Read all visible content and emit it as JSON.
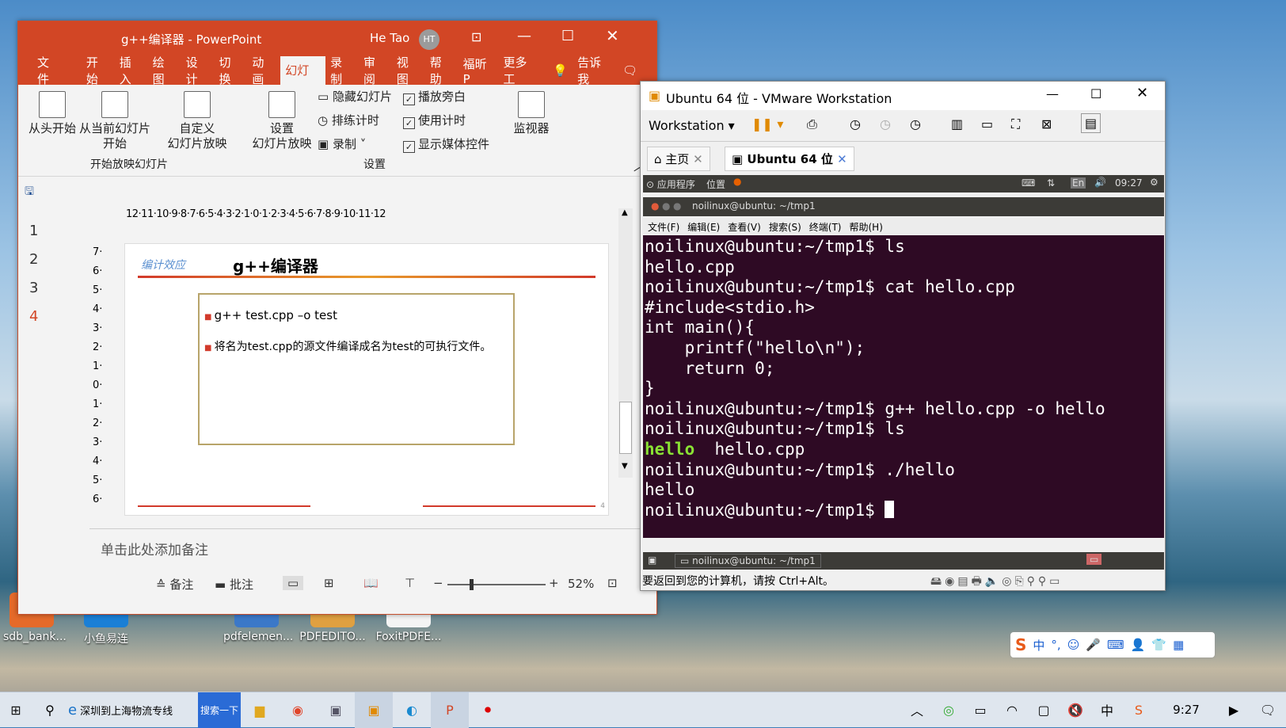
{
  "desktop": {
    "icons": [
      {
        "label": "sdb_bank..."
      },
      {
        "label": "小鱼易连"
      },
      {
        "label": "pdfelemen..."
      },
      {
        "label": "PDFEDITO..."
      },
      {
        "label": "FoxitPDFE..."
      }
    ]
  },
  "ppt": {
    "title": "g++编译器  -  PowerPoint",
    "user": "He Tao",
    "user_initials": "HT",
    "tabs": [
      "文件",
      "开始",
      "插入",
      "绘图",
      "设计",
      "切换",
      "动画",
      "幻灯片",
      "录制",
      "审阅",
      "视图",
      "帮助",
      "福昕P",
      "更多工",
      "告诉我"
    ],
    "ribbon": {
      "from_start": "从头开始",
      "from_current": "从当前幻灯片\n开始",
      "custom": "自定义\n幻灯片放映",
      "group1": "开始放映幻灯片",
      "setup": "设置\n幻灯片放映",
      "hide": "隐藏幻灯片",
      "rehearse": "排练计时",
      "record": "录制",
      "narration": "播放旁白",
      "timing": "使用计时",
      "media": "显示媒体控件",
      "group2": "设置",
      "monitor": "监视器"
    },
    "slides": [
      "1",
      "2",
      "3",
      "4"
    ],
    "ruler": "12·11·10·9·8·7·6·5·4·3·2·1·0·1·2·3·4·5·6·7·8·9·10·11·12",
    "vruler": "7·6·5·4·3·2·1·0·1·2·3·4·5·6·7",
    "slide": {
      "logo": "编计效应",
      "title": "g++编译器",
      "bullet1": "g++ test.cpp  –o test",
      "bullet2": "将名为test.cpp的源文件编译成名为test的可执行文件。",
      "page": "4"
    },
    "notes": "单击此处添加备注",
    "status": {
      "notes_btn": "备注",
      "comments_btn": "批注",
      "zoom": "52%"
    }
  },
  "vm": {
    "title": "Ubuntu 64 位 - VMware Workstation",
    "menu": "Workstation",
    "tabs": [
      "主页",
      "Ubuntu 64 位"
    ],
    "topbar": {
      "apps": "应用程序",
      "places": "位置",
      "time": "09:27",
      "lang": "En"
    },
    "term_title": "noilinux@ubuntu: ~/tmp1",
    "term_menu": [
      "文件(F)",
      "编辑(E)",
      "查看(V)",
      "搜索(S)",
      "终端(T)",
      "帮助(H)"
    ],
    "lines": [
      "noilinux@ubuntu:~/tmp1$ ls",
      "hello.cpp",
      "noilinux@ubuntu:~/tmp1$ cat hello.cpp",
      "#include<stdio.h>",
      "int main(){",
      "    printf(\"hello\\n\");",
      "    return 0;",
      "}",
      "noilinux@ubuntu:~/tmp1$ g++ hello.cpp -o hello",
      "noilinux@ubuntu:~/tmp1$ ls"
    ],
    "ls_hello": "hello",
    "ls_cpp": "  hello.cpp",
    "lines2": [
      "noilinux@ubuntu:~/tmp1$ ./hello",
      "hello"
    ],
    "prompt": "noilinux@ubuntu:~/tmp1$ ",
    "taskbar_item": "noilinux@ubuntu: ~/tmp1",
    "status": "要返回到您的计算机，请按 Ctrl+Alt。"
  },
  "taskbar": {
    "search_text": "深圳到上海物流专线",
    "search_btn": "搜索一下",
    "time": "9:27",
    "ime": "中"
  }
}
